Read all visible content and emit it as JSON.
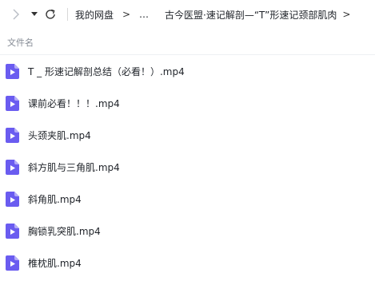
{
  "toolbar": {
    "breadcrumbs": [
      {
        "label": "我的网盘"
      },
      {
        "label": "…"
      },
      {
        "label": "古今医盟·速记解剖—“T”形速记颈部肌肉"
      }
    ],
    "separator": ">",
    "trailing_separator": ">"
  },
  "header": {
    "column_filename": "文件名"
  },
  "files": [
    {
      "name": "T _ 形速记解剖总结（必看！）.mp4"
    },
    {
      "name": "课前必看！！！.mp4"
    },
    {
      "name": "头颈夹肌.mp4"
    },
    {
      "name": "斜方肌与三角肌.mp4"
    },
    {
      "name": "斜角肌.mp4"
    },
    {
      "name": "胸锁乳突肌.mp4"
    },
    {
      "name": "椎枕肌.mp4"
    }
  ],
  "colors": {
    "video_icon": "#6a5cf0",
    "video_icon_fold": "#b3abf7"
  }
}
